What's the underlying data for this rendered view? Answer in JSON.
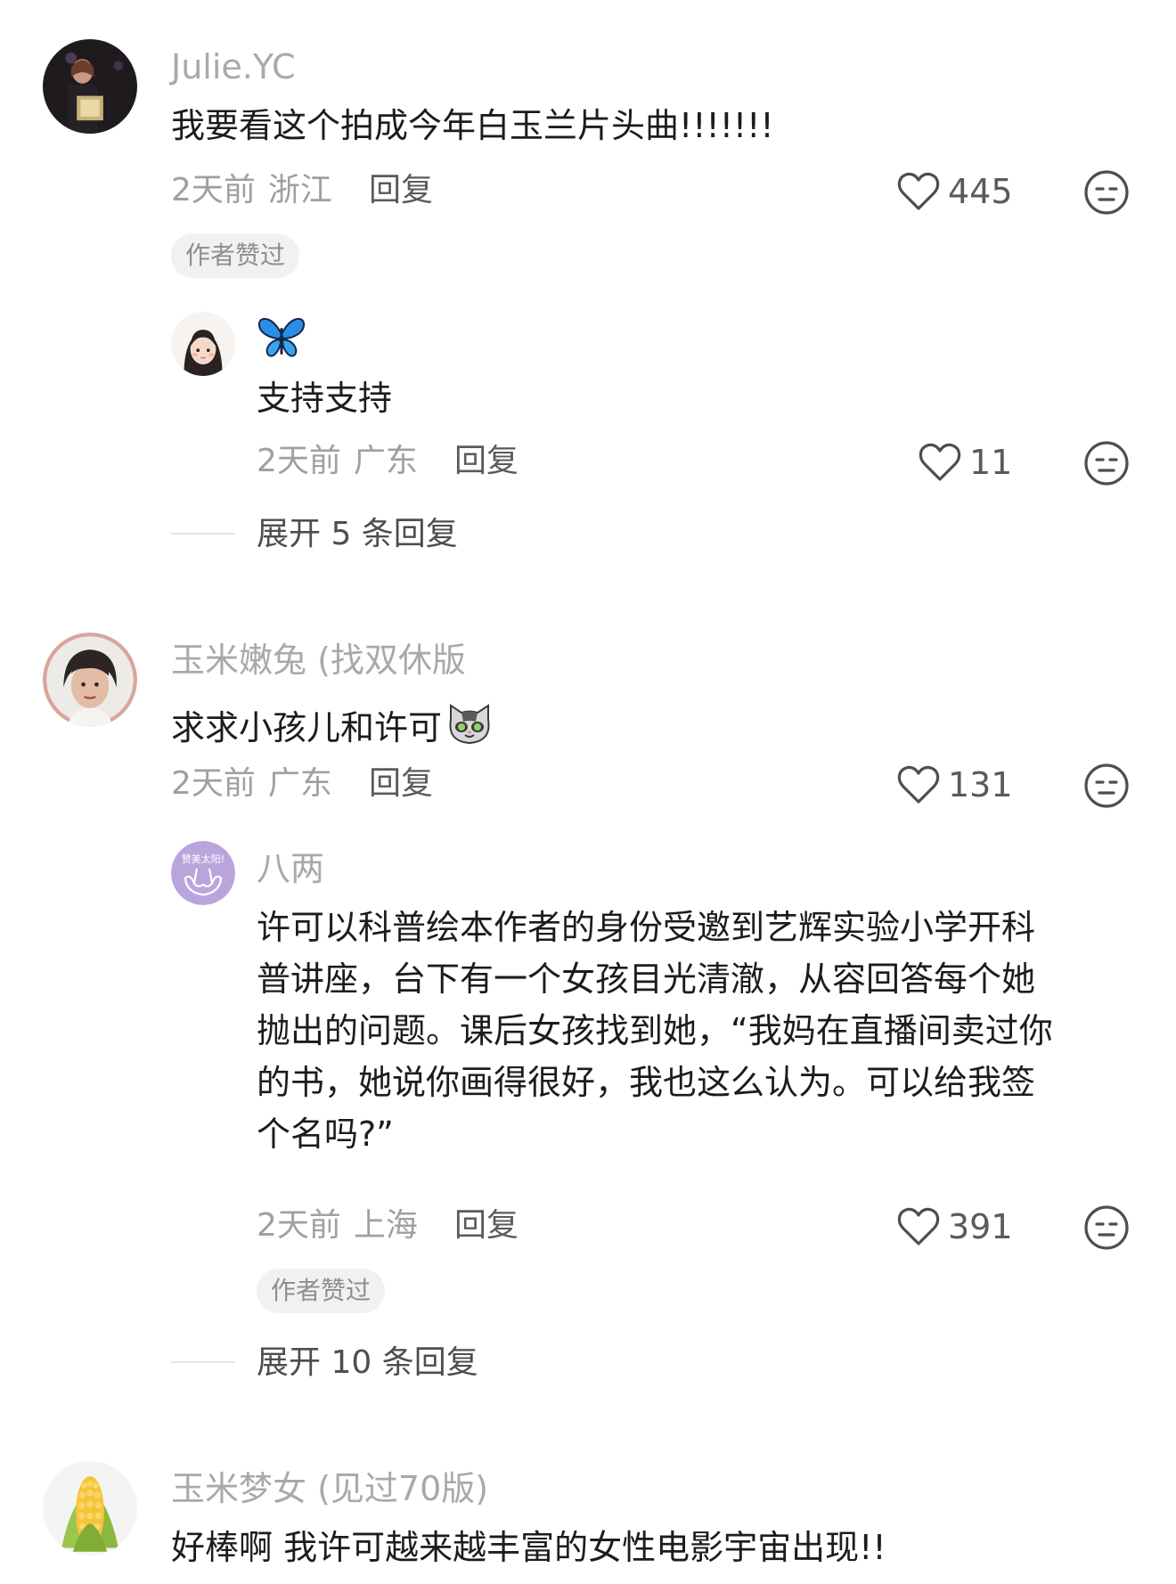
{
  "colors": {
    "username": "#a9a9a9",
    "text": "#1c1c1c",
    "meta": "#a0a0a0",
    "badge_bg": "#f1f1f1"
  },
  "comments": [
    {
      "username": "Julie.YC",
      "text": "我要看这个拍成今年白玉兰片头曲!!!!!!!",
      "time": "2天前",
      "location": "浙江",
      "reply_label": "回复",
      "likes": "445",
      "badge": "作者赞过",
      "replies": [
        {
          "username": "🦋",
          "text": "支持支持",
          "time": "2天前",
          "location": "广东",
          "reply_label": "回复",
          "likes": "11"
        }
      ],
      "expand_label": "展开 5 条回复"
    },
    {
      "username": "玉米嫩兔 (找双休版",
      "text": "求求小孩儿和许可",
      "emoji_icon": "cat-sticker-icon",
      "time": "2天前",
      "location": "广东",
      "reply_label": "回复",
      "likes": "131",
      "replies": [
        {
          "username": "八两",
          "avatar_text": "赞美太阳!",
          "text_lines": [
            "许可以科普绘本作者的身份受邀到艺辉实验小学开科",
            "普讲座，台下有一个女孩目光清澈，从容回答每个她",
            "抛出的问题。课后女孩找到她，“我妈在直播间卖过你",
            "的书，她说你画得很好，我也这么认为。可以给我签",
            "个名吗?”"
          ],
          "time": "2天前",
          "location": "上海",
          "reply_label": "回复",
          "likes": "391",
          "badge": "作者赞过"
        }
      ],
      "expand_label": "展开 10 条回复"
    },
    {
      "username": "玉米梦女 (见过70版)",
      "text": "好棒啊 我许可越来越丰富的女性电影宇宙出现!!"
    }
  ]
}
